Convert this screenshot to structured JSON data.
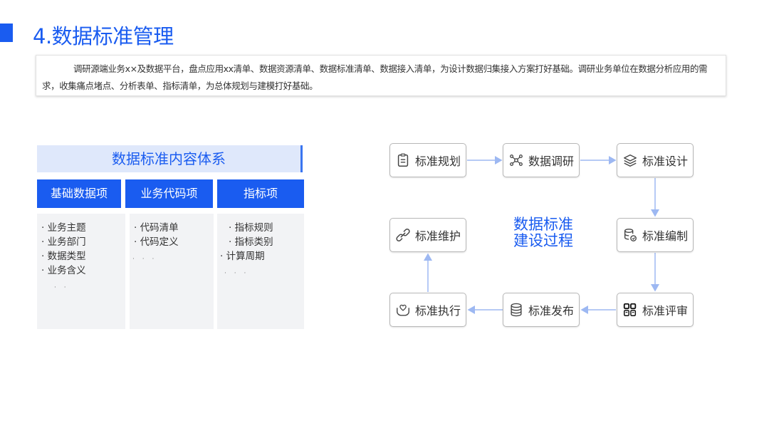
{
  "title": "4.数据标准管理",
  "description": "调研源端业务x×及数据平台，盘点应用xx清单、数据资源清单、数据标准清单、数据接入清单，为设计数据归集接入方案打好基础。调研业务单位在数据分析应用的需求，收集痛点堵点、分析表单、指标清单，为总体规划与建模打好基础。",
  "panel": {
    "header": "数据标准内容体系",
    "columns": [
      {
        "title": "基础数据项",
        "items": [
          "· 业务主题",
          "· 业务部门",
          "· 数据类型",
          "· 业务含义"
        ],
        "trailing": "· ·"
      },
      {
        "title": "业务代码项",
        "items": [
          "· 代码清单",
          "· 代码定义"
        ],
        "trailing": "· · ·"
      },
      {
        "title": "指标项",
        "items": [
          "· 指标规则",
          "· 指标类别",
          "· 计算周期"
        ],
        "trailing": "· · ·"
      }
    ]
  },
  "process": {
    "center_line1": "数据标准",
    "center_line2": "建设过程",
    "nodes": [
      {
        "label": "标准规划",
        "icon": "clipboard-icon"
      },
      {
        "label": "数据调研",
        "icon": "network-icon"
      },
      {
        "label": "标准设计",
        "icon": "layers-icon"
      },
      {
        "label": "标准编制",
        "icon": "database-sync-icon"
      },
      {
        "label": "标准评审",
        "icon": "review-icon"
      },
      {
        "label": "标准发布",
        "icon": "database-icon"
      },
      {
        "label": "标准执行",
        "icon": "hand-heart-icon"
      },
      {
        "label": "标准维护",
        "icon": "link-icon"
      }
    ]
  },
  "colors": {
    "accent": "#1a5cf0",
    "header_bg": "#dfe8fb",
    "body_bg": "#f2f3f5",
    "arrow": "#9db8f2"
  }
}
